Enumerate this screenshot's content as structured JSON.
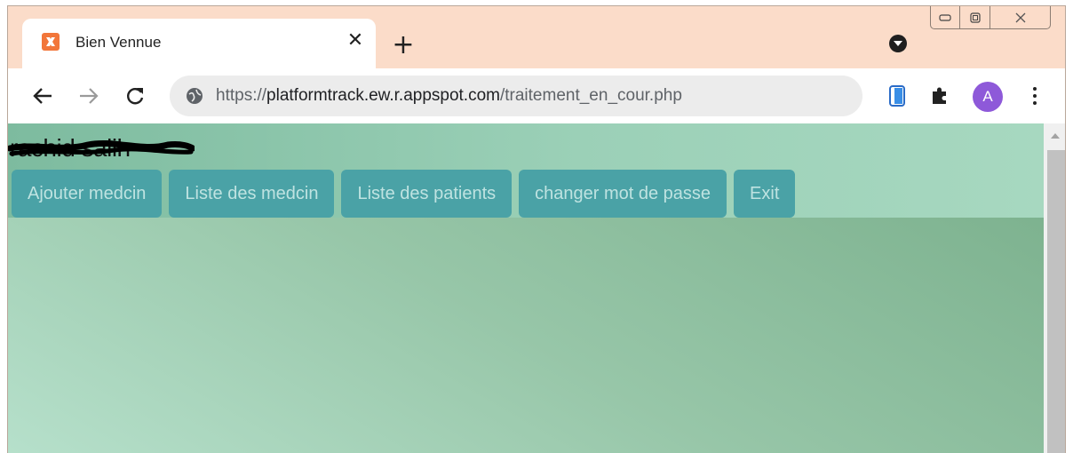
{
  "browser": {
    "tab": {
      "title": "Bien Vennue",
      "favicon": "xampp-icon",
      "close_symbol": "✕"
    },
    "new_tab_symbol": "+",
    "url": {
      "scheme": "https://",
      "host": "platformtrack.ew.r.appspot.com",
      "path": "/traitement_en_cour.php"
    },
    "profile_initial": "A",
    "colors": {
      "frame": "#fbdcc9",
      "avatar": "#8e59d9"
    }
  },
  "page": {
    "username": "rachid salih",
    "menu": [
      {
        "label": "Ajouter medcin"
      },
      {
        "label": "Liste des medcin"
      },
      {
        "label": "Liste des patients"
      },
      {
        "label": "changer mot de passe"
      },
      {
        "label": "Exit"
      }
    ],
    "colors": {
      "menu_button": "#4aa2a6",
      "menu_text": "#bfe3e1",
      "background_light": "#b6e0cb",
      "background_dark": "#78ae8a"
    }
  }
}
